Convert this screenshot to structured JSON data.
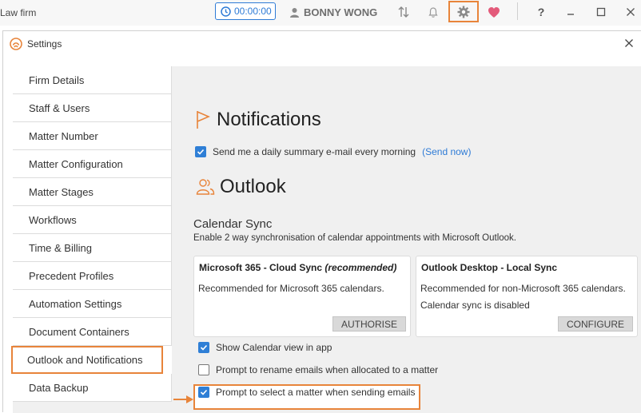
{
  "topbar": {
    "app_name": "Law firm",
    "timer": "00:00:00",
    "user_name": "BONNY WONG",
    "help": "?"
  },
  "dialog": {
    "title": "Settings"
  },
  "sidebar": {
    "items": [
      {
        "label": "Firm Details"
      },
      {
        "label": "Staff & Users"
      },
      {
        "label": "Matter Number"
      },
      {
        "label": "Matter Configuration"
      },
      {
        "label": "Matter Stages"
      },
      {
        "label": "Workflows"
      },
      {
        "label": "Time & Billing"
      },
      {
        "label": "Precedent Profiles"
      },
      {
        "label": "Automation Settings"
      },
      {
        "label": "Document Containers"
      },
      {
        "label": "Outlook and Notifications"
      },
      {
        "label": "Data Backup"
      }
    ],
    "active_index": 10
  },
  "notifications": {
    "heading": "Notifications",
    "daily_summary_label": "Send me a daily summary e-mail every morning",
    "daily_summary_checked": true,
    "send_now_link": "(Send now)"
  },
  "outlook": {
    "heading": "Outlook",
    "calendar_sync_heading": "Calendar Sync",
    "calendar_sync_desc": "Enable 2 way synchronisation of calendar appointments with Microsoft Outlook.",
    "cards": [
      {
        "title": "Microsoft 365 - Cloud Sync ",
        "title_em": "(recommended)",
        "line1": "Recommended for Microsoft 365 calendars.",
        "line2": "",
        "button": "AUTHORISE"
      },
      {
        "title": "Outlook Desktop - Local Sync",
        "title_em": "",
        "line1": "Recommended for non-Microsoft 365 calendars.",
        "line2": "Calendar sync is disabled",
        "button": "CONFIGURE"
      }
    ],
    "options": [
      {
        "label": "Show Calendar view in app",
        "checked": true
      },
      {
        "label": "Prompt to rename emails when allocated to a matter",
        "checked": false
      },
      {
        "label": "Prompt to select a matter when sending emails",
        "checked": true
      }
    ]
  },
  "colors": {
    "accent": "#2e7bd6",
    "highlight": "#e8843a",
    "heart": "#e35a7a"
  }
}
